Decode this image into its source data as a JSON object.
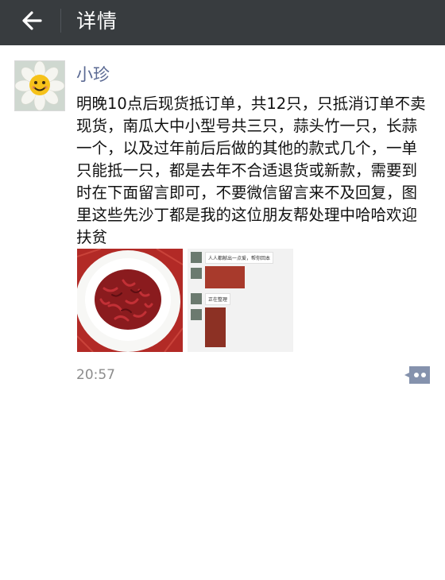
{
  "header": {
    "back_icon": "arrow-left-icon",
    "title": "详情"
  },
  "post": {
    "author": "小珍",
    "text": "明晚10点后现货抵订单，共12只，只抵消订单不卖现货，南瓜大中小型号共三只，蒜头竹一只，长蒜一个，以及过年前后后做的其他的款式几个，一单只能抵一只，都是去年不合适退货或新款，需要到时在下面留言即可，不要微信留言来不及回复，图里这些先沙丁都是我的这位朋友帮处理中哈哈欢迎扶贫",
    "images": [
      {
        "name": "bowl-photo"
      },
      {
        "name": "chat-screenshot",
        "messages": [
          "人人都献出一点爱，帮你回本",
          "正在整理"
        ]
      }
    ],
    "time": "20:57",
    "comment_icon": "comment-dots-icon"
  },
  "colors": {
    "topbar": "#383c3f",
    "author": "#5b6a93",
    "comment_button": "#8592ad"
  }
}
